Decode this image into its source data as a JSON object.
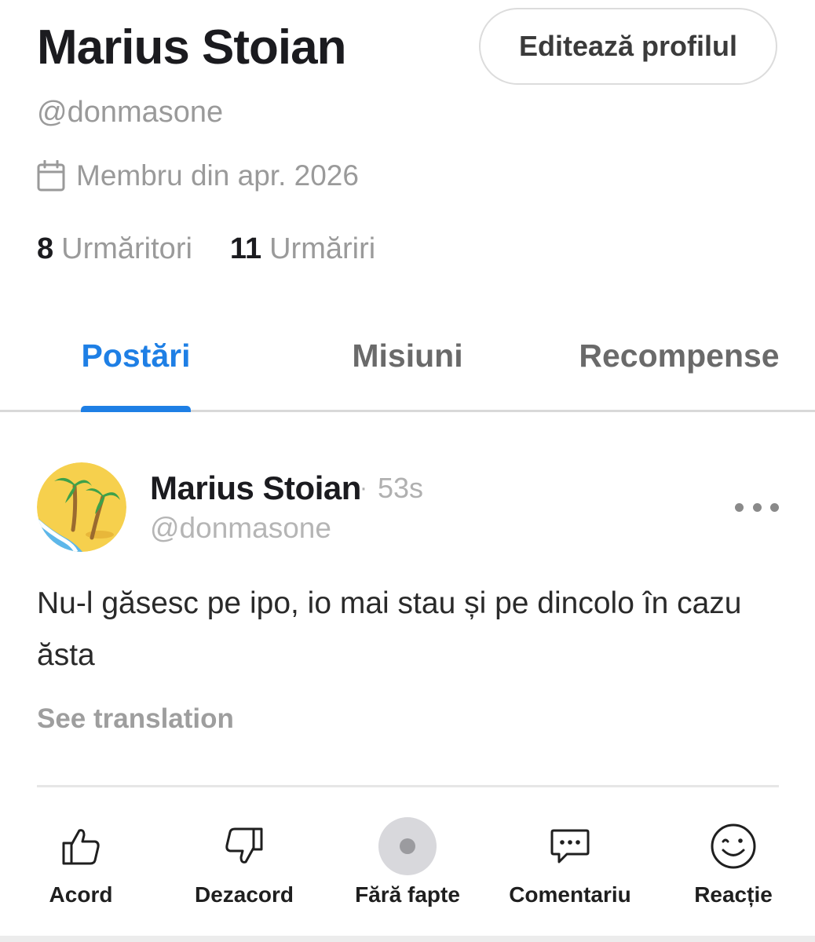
{
  "profile": {
    "name": "Marius Stoian",
    "handle": "@donmasone",
    "member_since": "Membru din apr. 2026",
    "edit_button": "Editează profilul",
    "followers_count": "8",
    "followers_label": "Urmăritori",
    "following_count": "11",
    "following_label": "Urmăriri"
  },
  "tabs": [
    {
      "label": "Postări",
      "active": true
    },
    {
      "label": "Misiuni",
      "active": false
    },
    {
      "label": "Recompense",
      "active": false
    }
  ],
  "post": {
    "author": "Marius Stoian",
    "separator": "·",
    "time": "53s",
    "handle": "@donmasone",
    "avatar_icon": "desert-island-icon",
    "text": "Nu-l găsesc pe ipo, io mai stau și pe dincolo în cazu ăsta",
    "see_translation": "See translation"
  },
  "actions": [
    {
      "label": "Acord",
      "icon": "thumbs-up-icon"
    },
    {
      "label": "Dezacord",
      "icon": "thumbs-down-icon"
    },
    {
      "label": "Fără fapte",
      "icon": "no-facts-icon"
    },
    {
      "label": "Comentariu",
      "icon": "comment-icon"
    },
    {
      "label": "Reacție",
      "icon": "emoji-smile-icon"
    }
  ],
  "colors": {
    "accent": "#1e7fe5",
    "muted_text": "#9a9a9a",
    "primary_text": "#1b1b1f"
  }
}
